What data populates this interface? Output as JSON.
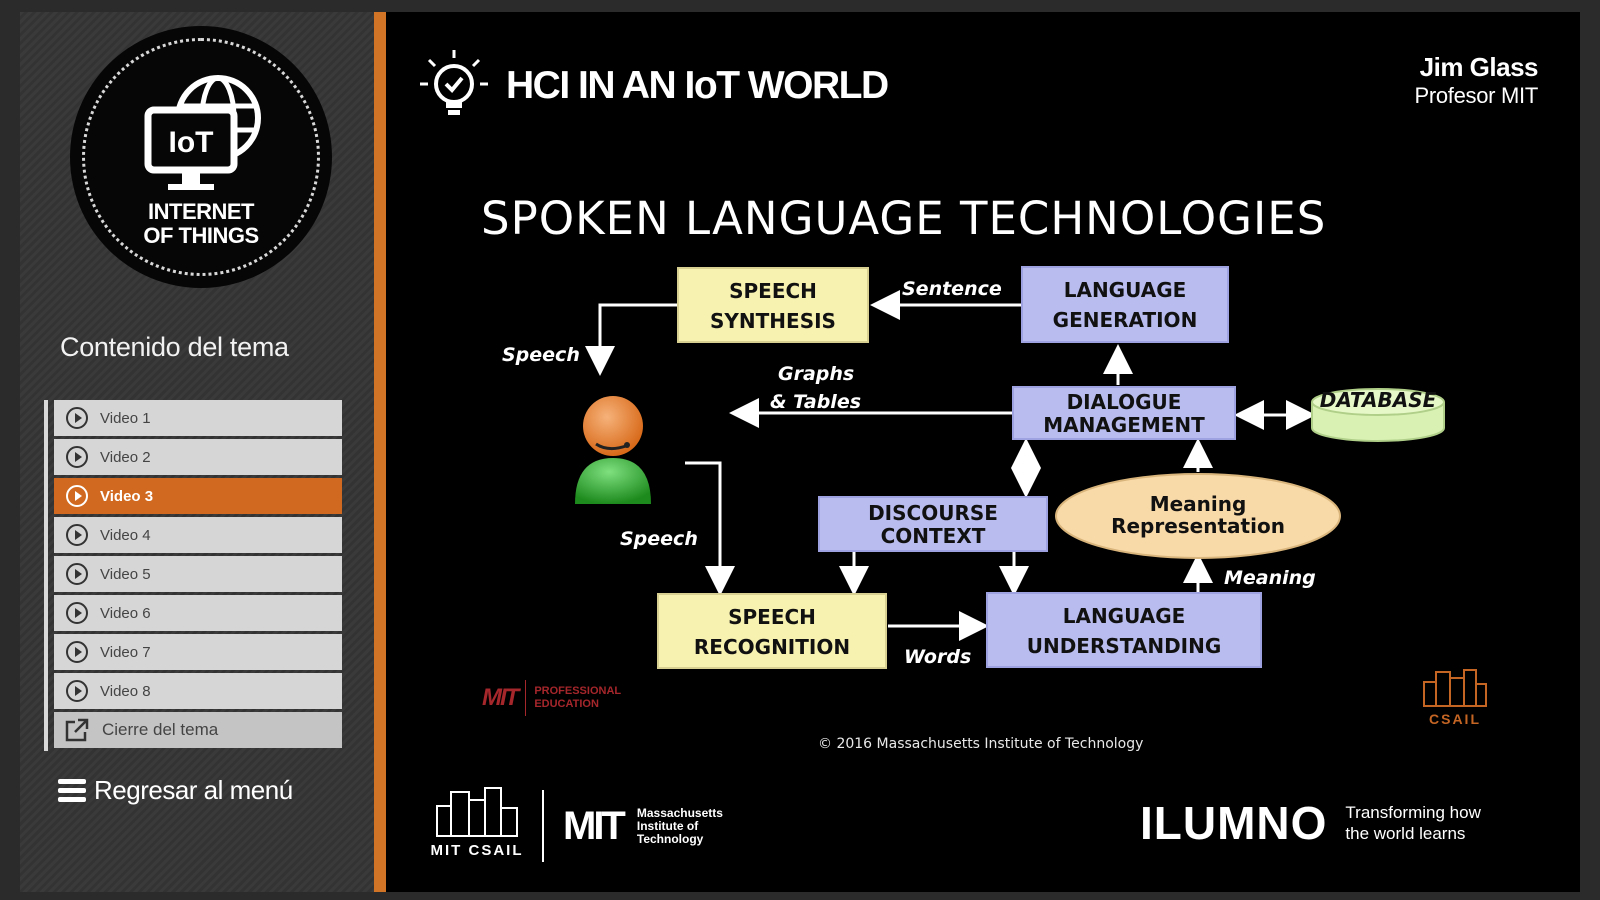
{
  "sidebar": {
    "badge_line1": "INTERNET",
    "badge_line2": "OF THINGS",
    "badge_icon_text": "IoT",
    "toc_heading": "Contenido del tema",
    "items": [
      {
        "label": "Video 1",
        "icon": "play-circle-icon"
      },
      {
        "label": "Video 2",
        "icon": "play-circle-icon"
      },
      {
        "label": "Video 3",
        "icon": "play-circle-icon",
        "active": true
      },
      {
        "label": "Video 4",
        "icon": "play-circle-icon"
      },
      {
        "label": "Video 5",
        "icon": "play-circle-icon"
      },
      {
        "label": "Video 6",
        "icon": "play-circle-icon"
      },
      {
        "label": "Video 7",
        "icon": "play-circle-icon"
      },
      {
        "label": "Video 8",
        "icon": "play-circle-icon"
      }
    ],
    "close_label": "Cierre del tema",
    "back_label": "Regresar al menú"
  },
  "header": {
    "course_title": "HCI IN AN IoT WORLD",
    "presenter_name": "Jim Glass",
    "presenter_role": "Profesor MIT"
  },
  "slide": {
    "title": "SPOKEN LANGUAGE TECHNOLOGIES",
    "nodes": {
      "speech_synthesis": [
        "SPEECH",
        "SYNTHESIS"
      ],
      "language_generation": [
        "LANGUAGE",
        "GENERATION"
      ],
      "dialogue_management": [
        "DIALOGUE",
        "MANAGEMENT"
      ],
      "database": "DATABASE",
      "discourse_context": [
        "DISCOURSE",
        "CONTEXT"
      ],
      "meaning_representation": [
        "Meaning",
        "Representation"
      ],
      "speech_recognition": [
        "SPEECH",
        "RECOGNITION"
      ],
      "language_understanding": [
        "LANGUAGE",
        "UNDERSTANDING"
      ]
    },
    "edge_labels": {
      "sentence": "Sentence",
      "speech_out": "Speech",
      "graphs": "Graphs",
      "tables": "& Tables",
      "speech_in": "Speech",
      "words": "Words",
      "meaning": "Meaning"
    },
    "logo_mitpe_mark": "MIT",
    "logo_mitpe_line1": "PROFESSIONAL",
    "logo_mitpe_line2": "EDUCATION",
    "logo_csail_small": "CSAIL",
    "copyright": "© 2016 Massachusetts Institute of Technology"
  },
  "footer": {
    "csail": "MIT CSAIL",
    "mit_mark": "MIT",
    "mit_line1": "Massachusetts",
    "mit_line2": "Institute of",
    "mit_line3": "Technology",
    "ilumno_brand": "ILUMNO",
    "ilumno_tag1": "Transforming how",
    "ilumno_tag2": "the world learns"
  },
  "colors": {
    "accent": "#d27426",
    "yellow_box": "#f8f2b0",
    "blue_box": "#b9bcef",
    "ellipse": "#f8d9a8",
    "database": "#d9f2b4"
  }
}
